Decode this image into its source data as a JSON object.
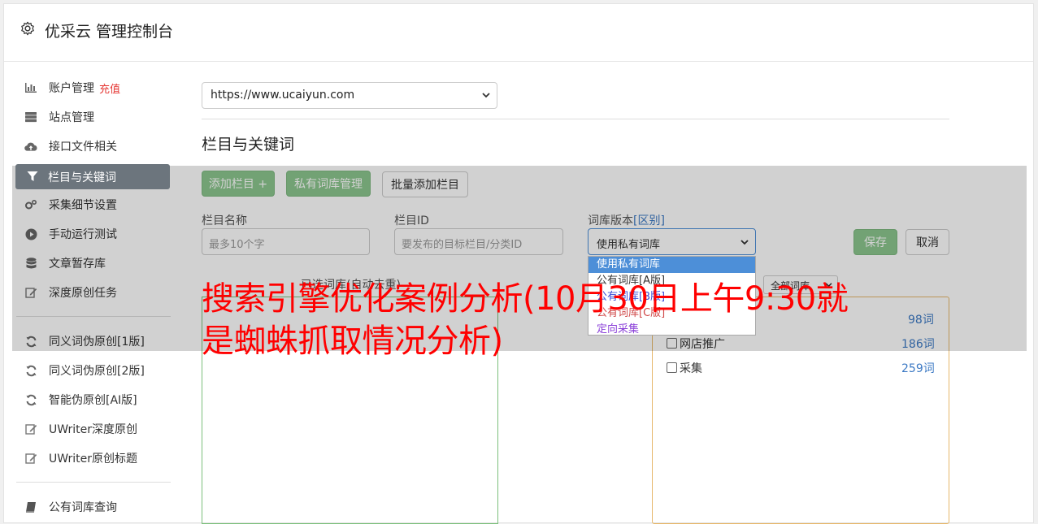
{
  "header": {
    "title": "优采云 管理控制台",
    "icon": "gear-icon"
  },
  "sidebar": {
    "items": [
      {
        "label": "账户管理",
        "extra": "充值",
        "icon": "bar-chart-icon"
      },
      {
        "label": "站点管理",
        "icon": "server-icon"
      },
      {
        "label": "接口文件相关",
        "icon": "cloud-upload-icon"
      },
      {
        "label": "栏目与关键词",
        "icon": "filter-icon",
        "active": true
      },
      {
        "label": "采集细节设置",
        "icon": "cogs-icon"
      },
      {
        "label": "手动运行测试",
        "icon": "play-circle-icon"
      },
      {
        "label": "文章暂存库",
        "icon": "database-icon"
      },
      {
        "label": "深度原创任务",
        "icon": "edit-icon"
      },
      {
        "label": "同义词伪原创[1版]",
        "icon": "refresh-icon"
      },
      {
        "label": "同义词伪原创[2版]",
        "icon": "refresh-icon"
      },
      {
        "label": "智能伪原创[AI版]",
        "icon": "refresh-icon"
      },
      {
        "label": "UWriter深度原创",
        "icon": "edit-icon"
      },
      {
        "label": "UWriter原创标题",
        "icon": "edit-icon"
      },
      {
        "label": "公有词库查询",
        "icon": "book-icon"
      }
    ]
  },
  "content": {
    "site_select_value": "https://www.ucaiyun.com",
    "section_title": "栏目与关键词",
    "buttons": {
      "add_column": "添加栏目 +",
      "private_lib": "私有词库管理",
      "batch_add": "批量添加栏目",
      "save": "保存",
      "cancel": "取消"
    },
    "fields": {
      "column_name_label": "栏目名称",
      "column_name_placeholder": "最多10个字",
      "column_id_label": "栏目ID",
      "column_id_placeholder": "要发布的目标栏目/分类ID",
      "lib_version_label": "词库版本",
      "lib_version_link": "[区别]",
      "lib_version_value": "使用私有词库"
    },
    "dropdown_options": [
      {
        "label": "使用私有词库",
        "color": "#ffffff"
      },
      {
        "label": "公有词库[A版]",
        "color": "#333333"
      },
      {
        "label": "公有词库[B版]",
        "color": "#3b4fd8"
      },
      {
        "label": "公有词库[C版]",
        "color": "#d04a4a"
      },
      {
        "label": "定向采集",
        "color": "#8a3fd8"
      }
    ],
    "selected_hint": "已选词库(自动去重)",
    "all_lib_select": "全部词库",
    "word_rows": [
      {
        "label": "",
        "count": "98词"
      },
      {
        "label": "网店推广",
        "count": "186词"
      },
      {
        "label": "采集",
        "count": "259词"
      }
    ]
  },
  "overlay_text": "搜索引擎优化案例分析(10月30日上午9:30就是蜘蛛抓取情况分析)",
  "colors": {
    "accent_green": "#8bc68e",
    "link_blue": "#3c79c4",
    "overlay_red": "#ff0000"
  }
}
